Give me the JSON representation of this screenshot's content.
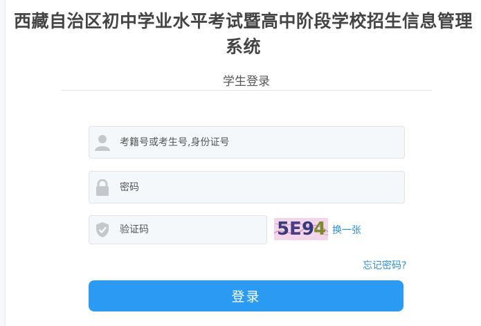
{
  "page": {
    "title": "西藏自治区初中学业水平考试暨高中阶段学校招生信息管理系统",
    "subtitle": "学生登录"
  },
  "form": {
    "username": {
      "placeholder": "考籍号或考生号,身份证号",
      "value": "",
      "icon": "user-icon"
    },
    "password": {
      "placeholder": "密码",
      "value": "",
      "icon": "lock-icon"
    },
    "captcha": {
      "placeholder": "验证码",
      "value": "",
      "icon": "shield-check-icon",
      "image_text": "5E94",
      "refresh_label": "换一张"
    },
    "forgot_label": "忘记密码?",
    "submit_label": "登录"
  },
  "colors": {
    "accent": "#2b9af3",
    "link": "#2f8fd8",
    "field_bg": "#f5f8fb",
    "captcha_bg": "#f3d6ea"
  }
}
